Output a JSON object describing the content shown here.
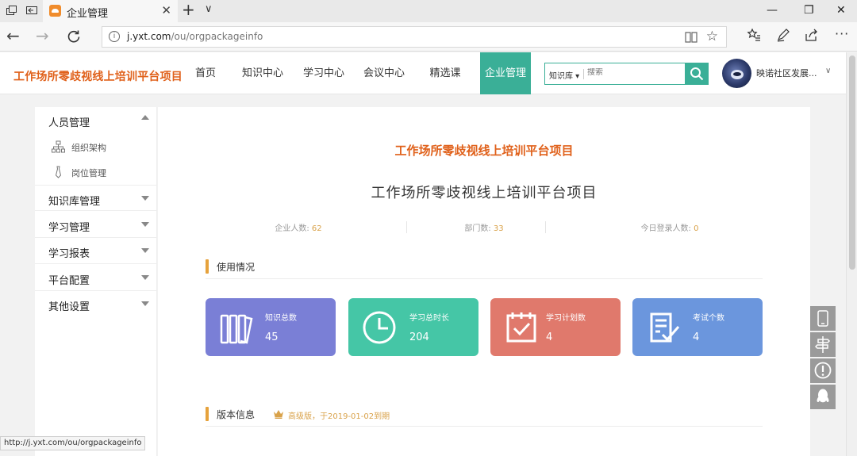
{
  "browser": {
    "tab_title": "企业管理",
    "tab_close": "✕",
    "new_tab": "+",
    "tab_menu": "∨",
    "url_host": "j.yxt.com",
    "url_path": "/ou/orgpackageinfo",
    "window_controls": [
      "—",
      "❐",
      "✕"
    ],
    "status_url": "http://j.yxt.com/ou/orgpackageinfo"
  },
  "header": {
    "logo_text": "工作场所零歧视线上培训平台项目",
    "nav": [
      {
        "label": "首页",
        "active": false
      },
      {
        "label": "知识中心",
        "active": false
      },
      {
        "label": "学习中心",
        "active": false,
        "dot": true
      },
      {
        "label": "会议中心",
        "active": false
      },
      {
        "label": "精选课",
        "active": false
      },
      {
        "label": "企业管理",
        "active": true
      }
    ],
    "search": {
      "scope": "知识库",
      "placeholder": "搜索"
    },
    "user_name": "映诺社区发展..."
  },
  "sidebar": {
    "groups": [
      {
        "label": "人员管理",
        "expanded": true,
        "children": [
          {
            "label": "组织架构",
            "icon": "org-chart-icon"
          },
          {
            "label": "岗位管理",
            "icon": "tie-icon"
          }
        ]
      },
      {
        "label": "知识库管理",
        "expanded": false
      },
      {
        "label": "学习管理",
        "expanded": false
      },
      {
        "label": "学习报表",
        "expanded": false
      },
      {
        "label": "平台配置",
        "expanded": false
      },
      {
        "label": "其他设置",
        "expanded": false
      }
    ]
  },
  "main": {
    "logo_text": "工作场所零歧视线上培训平台项目",
    "title": "工作场所零歧视线上培训平台项目",
    "stats": [
      {
        "label": "企业人数: ",
        "value": "62"
      },
      {
        "label": "部门数: ",
        "value": "33"
      },
      {
        "label": "今日登录人数: ",
        "value": "0"
      }
    ],
    "usage_title": "使用情况",
    "cards": [
      {
        "label": "知识总数",
        "value": "45",
        "color": "#7a7fd6",
        "icon": "books-icon"
      },
      {
        "label": "学习总时长",
        "value": "204",
        "color": "#45c6a6",
        "icon": "clock-icon"
      },
      {
        "label": "学习计划数",
        "value": "4",
        "color": "#e0796c",
        "icon": "calendar-check-icon"
      },
      {
        "label": "考试个数",
        "value": "4",
        "color": "#6b96dd",
        "icon": "exam-icon"
      }
    ],
    "version_title": "版本信息",
    "version_text": "高级版，于2019-01-02到期"
  },
  "colors": {
    "accent": "#3aaf97",
    "brand": "#e0611b",
    "gold": "#d9a24a"
  }
}
